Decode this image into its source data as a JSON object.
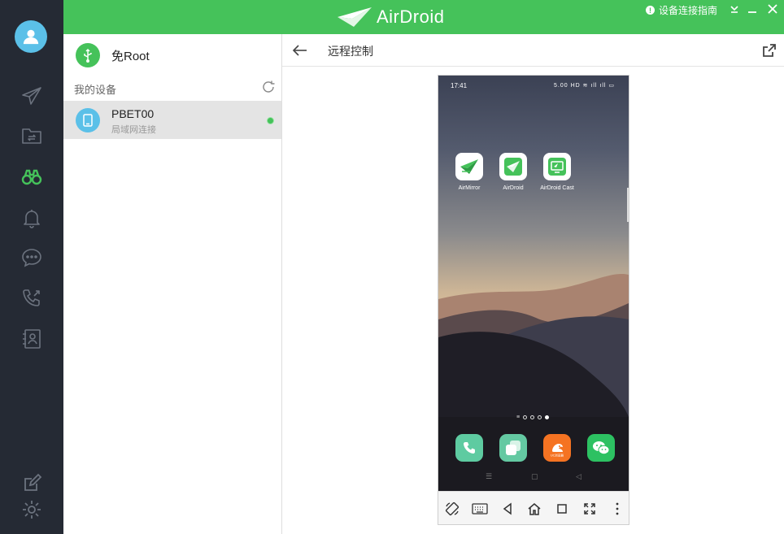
{
  "window": {
    "app_name": "AirDroid",
    "guide_label": "设备连接指南"
  },
  "device_panel": {
    "noroot_label": "免Root",
    "my_devices_title": "我的设备",
    "devices": [
      {
        "name": "PBET00",
        "connection": "局域网连接",
        "online": true
      }
    ]
  },
  "content": {
    "title": "远程控制"
  },
  "phone": {
    "status_time": "17:41",
    "status_icons": "5.00 HD ≋ ıll ıll ▭",
    "apps": [
      {
        "label": "AirMirror"
      },
      {
        "label": "AirDroid"
      },
      {
        "label": "AirDroid Cast"
      }
    ],
    "dock": [
      "phone-app",
      "multitask-app",
      "uc-browser-app",
      "wechat-app"
    ],
    "uc_label": "UC浏览器",
    "nav_glyphs": {
      "menu": "☰",
      "home": "▢",
      "back": "◁"
    },
    "page_dots": 4,
    "active_dot": 4
  },
  "colors": {
    "brand_green": "#45c25a",
    "rail_bg": "#252a34",
    "accent_blue": "#5bc0e8"
  }
}
